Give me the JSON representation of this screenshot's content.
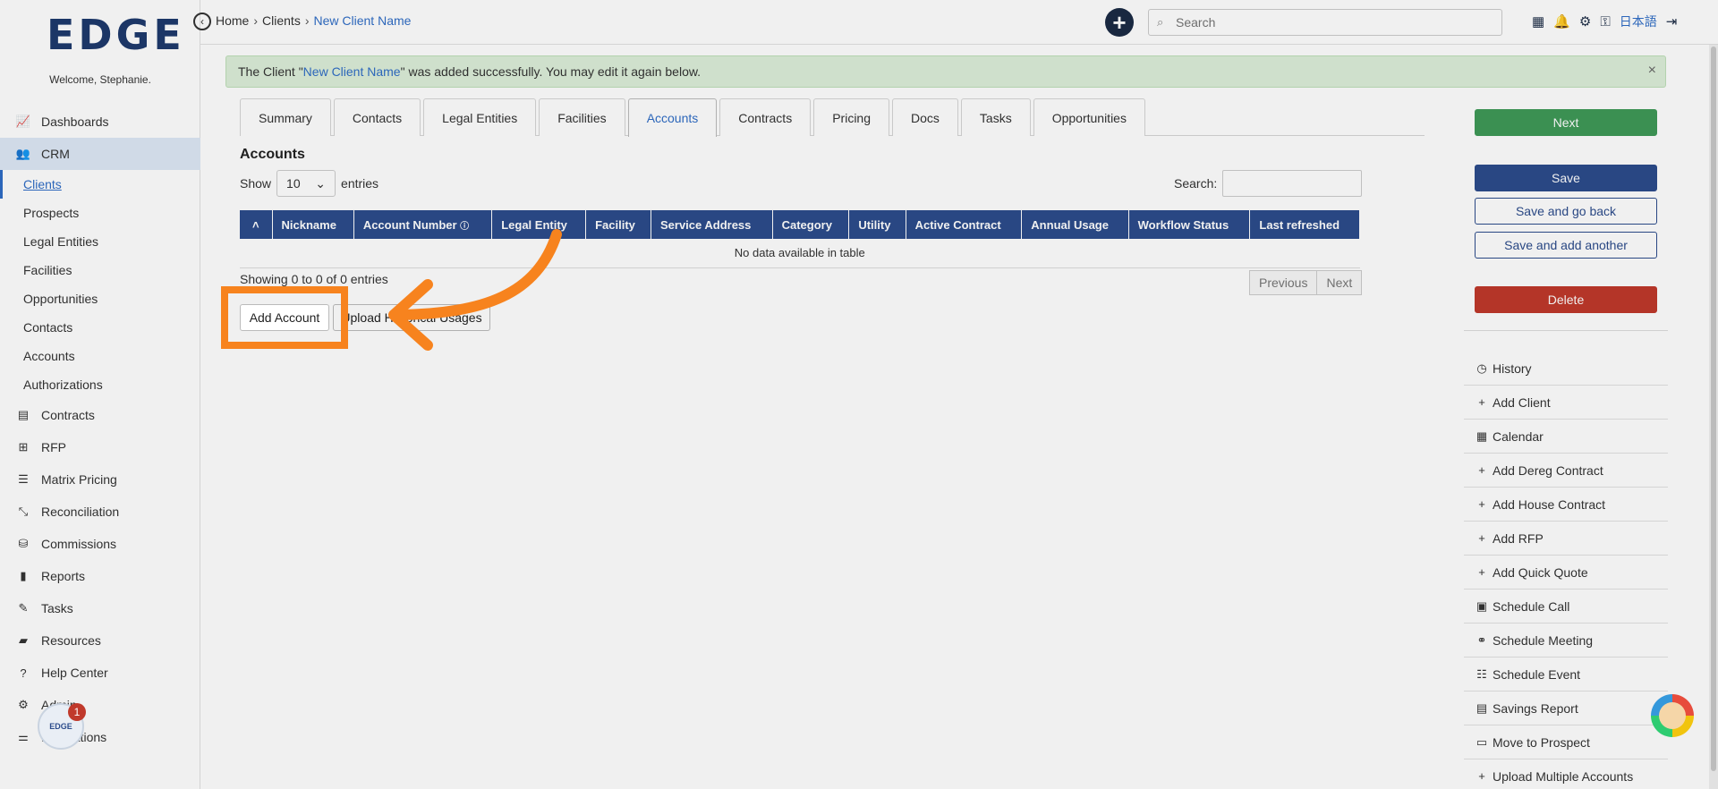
{
  "app": {
    "logo": "EDGE",
    "welcome": "Welcome, Stephanie."
  },
  "sidebar": {
    "items": [
      {
        "label": "Dashboards",
        "icon": "chart-line-icon"
      },
      {
        "label": "CRM",
        "icon": "users-icon",
        "active": true
      },
      {
        "label": "Contracts",
        "icon": "file-icon"
      },
      {
        "label": "RFP",
        "icon": "sitemap-icon"
      },
      {
        "label": "Matrix Pricing",
        "icon": "list-icon"
      },
      {
        "label": "Reconciliation",
        "icon": "compress-icon"
      },
      {
        "label": "Commissions",
        "icon": "coins-icon"
      },
      {
        "label": "Reports",
        "icon": "bar-chart-icon"
      },
      {
        "label": "Tasks",
        "icon": "tasks-icon"
      },
      {
        "label": "Resources",
        "icon": "folder-icon"
      },
      {
        "label": "Help Center",
        "icon": "question-icon"
      },
      {
        "label": "Admin",
        "icon": "cogs-icon"
      },
      {
        "label": "Integrations",
        "icon": "sliders-icon"
      }
    ],
    "crm_sub": [
      "Clients",
      "Prospects",
      "Legal Entities",
      "Facilities",
      "Opportunities",
      "Contacts",
      "Accounts",
      "Authorizations"
    ]
  },
  "topbar": {
    "breadcrumb": [
      "Home",
      "Clients",
      "New Client Name"
    ],
    "search_placeholder": "Search",
    "language": "日本語"
  },
  "alert": {
    "prefix": "The Client \"",
    "client_name": "New Client Name",
    "suffix": "\" was added successfully. You may edit it again below.",
    "close": "×"
  },
  "tabs": [
    "Summary",
    "Contacts",
    "Legal Entities",
    "Facilities",
    "Accounts",
    "Contracts",
    "Pricing",
    "Docs",
    "Tasks",
    "Opportunities"
  ],
  "active_tab": "Accounts",
  "accounts": {
    "title": "Accounts",
    "show_label": "Show",
    "entries_value": "10",
    "entries_label": "entries",
    "search_label": "Search:",
    "columns": [
      "Nickname",
      "Account Number",
      "Legal Entity",
      "Facility",
      "Service Address",
      "Category",
      "Utility",
      "Active Contract",
      "Annual Usage",
      "Workflow Status",
      "Last refreshed"
    ],
    "empty_message": "No data available in table",
    "showing": "Showing 0 to 0 of 0 entries",
    "prev": "Previous",
    "next": "Next",
    "add_button": "Add Account",
    "upload_button": "Upload Historical Usages"
  },
  "right": {
    "next": "Next",
    "save": "Save",
    "save_back": "Save and go back",
    "save_another": "Save and add another",
    "delete": "Delete",
    "actions": [
      {
        "label": "History",
        "icon": "clock-icon"
      },
      {
        "label": "Add Client",
        "icon": "plus-icon"
      },
      {
        "label": "Calendar",
        "icon": "calendar-icon"
      },
      {
        "label": "Add Dereg Contract",
        "icon": "plus-icon"
      },
      {
        "label": "Add House Contract",
        "icon": "plus-icon"
      },
      {
        "label": "Add RFP",
        "icon": "plus-icon"
      },
      {
        "label": "Add Quick Quote",
        "icon": "plus-icon"
      },
      {
        "label": "Schedule Call",
        "icon": "calendar-check-icon"
      },
      {
        "label": "Schedule Meeting",
        "icon": "handshake-icon"
      },
      {
        "label": "Schedule Event",
        "icon": "server-icon"
      },
      {
        "label": "Savings Report",
        "icon": "file-icon"
      },
      {
        "label": "Move to Prospect",
        "icon": "id-card-icon"
      },
      {
        "label": "Upload Multiple Accounts",
        "icon": "plus-icon"
      }
    ]
  },
  "widgets": {
    "help_count": "1"
  },
  "colors": {
    "navy": "#2c4c8c",
    "green": "#3f9a58",
    "red": "#c0392b",
    "link": "#2f6dc6",
    "highlight": "#f7831e"
  }
}
